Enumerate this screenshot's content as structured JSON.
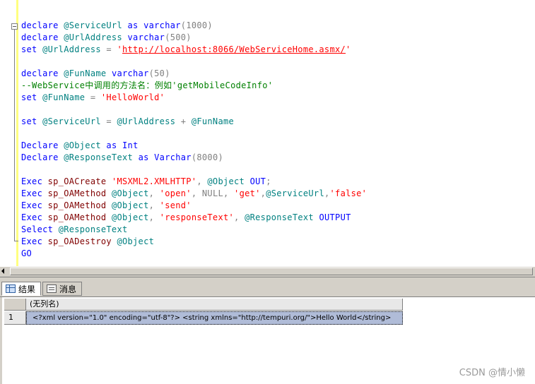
{
  "editor": {
    "fold_symbol": "−",
    "lines": [
      [
        {
          "t": "declare ",
          "c": "kw"
        },
        {
          "t": "@ServiceUrl",
          "c": "var"
        },
        {
          "t": " ",
          "c": ""
        },
        {
          "t": "as",
          "c": "kw"
        },
        {
          "t": " ",
          "c": ""
        },
        {
          "t": "varchar",
          "c": "kw"
        },
        {
          "t": "(1000)",
          "c": "gry"
        }
      ],
      [
        {
          "t": "declare ",
          "c": "kw"
        },
        {
          "t": "@UrlAddress",
          "c": "var"
        },
        {
          "t": " ",
          "c": ""
        },
        {
          "t": "varchar",
          "c": "kw"
        },
        {
          "t": "(500)",
          "c": "gry"
        }
      ],
      [
        {
          "t": "set ",
          "c": "kw"
        },
        {
          "t": "@UrlAddress",
          "c": "var"
        },
        {
          "t": " = ",
          "c": "gry"
        },
        {
          "t": "'",
          "c": "str"
        },
        {
          "t": "http://localhost:8066/WebServiceHome.asmx/",
          "c": "url"
        },
        {
          "t": "'",
          "c": "str"
        }
      ],
      [],
      [
        {
          "t": "declare ",
          "c": "kw"
        },
        {
          "t": "@FunName",
          "c": "var"
        },
        {
          "t": " ",
          "c": ""
        },
        {
          "t": "varchar",
          "c": "kw"
        },
        {
          "t": "(50)",
          "c": "gry"
        }
      ],
      [
        {
          "t": "--WebService中调用的方法名：例如'getMobileCodeInfo'",
          "c": "cmt"
        }
      ],
      [
        {
          "t": "set ",
          "c": "kw"
        },
        {
          "t": "@FunName",
          "c": "var"
        },
        {
          "t": " = ",
          "c": "gry"
        },
        {
          "t": "'HelloWorld'",
          "c": "str"
        }
      ],
      [],
      [
        {
          "t": "set ",
          "c": "kw"
        },
        {
          "t": "@ServiceUrl",
          "c": "var"
        },
        {
          "t": " = ",
          "c": "gry"
        },
        {
          "t": "@UrlAddress",
          "c": "var"
        },
        {
          "t": " + ",
          "c": "gry"
        },
        {
          "t": "@FunName",
          "c": "var"
        }
      ],
      [],
      [
        {
          "t": "Declare ",
          "c": "kw"
        },
        {
          "t": "@Object",
          "c": "var"
        },
        {
          "t": " ",
          "c": ""
        },
        {
          "t": "as",
          "c": "kw"
        },
        {
          "t": " ",
          "c": ""
        },
        {
          "t": "Int",
          "c": "kw"
        }
      ],
      [
        {
          "t": "Declare ",
          "c": "kw"
        },
        {
          "t": "@ResponseText",
          "c": "var"
        },
        {
          "t": " ",
          "c": ""
        },
        {
          "t": "as",
          "c": "kw"
        },
        {
          "t": " ",
          "c": ""
        },
        {
          "t": "Varchar",
          "c": "kw"
        },
        {
          "t": "(8000)",
          "c": "gry"
        }
      ],
      [],
      [
        {
          "t": "Exec ",
          "c": "kw"
        },
        {
          "t": "sp_OACreate",
          "c": "fn"
        },
        {
          "t": " ",
          "c": ""
        },
        {
          "t": "'MSXML2.XMLHTTP'",
          "c": "str"
        },
        {
          "t": ", ",
          "c": "gry"
        },
        {
          "t": "@Object",
          "c": "var"
        },
        {
          "t": " ",
          "c": ""
        },
        {
          "t": "OUT",
          "c": "kw"
        },
        {
          "t": ";",
          "c": "gry"
        }
      ],
      [
        {
          "t": "Exec ",
          "c": "kw"
        },
        {
          "t": "sp_OAMethod",
          "c": "fn"
        },
        {
          "t": " ",
          "c": ""
        },
        {
          "t": "@Object",
          "c": "var"
        },
        {
          "t": ", ",
          "c": "gry"
        },
        {
          "t": "'open'",
          "c": "str"
        },
        {
          "t": ", NULL, ",
          "c": "gry"
        },
        {
          "t": "'get'",
          "c": "str"
        },
        {
          "t": ",",
          "c": "gry"
        },
        {
          "t": "@ServiceUrl",
          "c": "var"
        },
        {
          "t": ",",
          "c": "gry"
        },
        {
          "t": "'false'",
          "c": "str"
        }
      ],
      [
        {
          "t": "Exec ",
          "c": "kw"
        },
        {
          "t": "sp_OAMethod",
          "c": "fn"
        },
        {
          "t": " ",
          "c": ""
        },
        {
          "t": "@Object",
          "c": "var"
        },
        {
          "t": ", ",
          "c": "gry"
        },
        {
          "t": "'send'",
          "c": "str"
        }
      ],
      [
        {
          "t": "Exec ",
          "c": "kw"
        },
        {
          "t": "sp_OAMethod",
          "c": "fn"
        },
        {
          "t": " ",
          "c": ""
        },
        {
          "t": "@Object",
          "c": "var"
        },
        {
          "t": ", ",
          "c": "gry"
        },
        {
          "t": "'responseText'",
          "c": "str"
        },
        {
          "t": ", ",
          "c": "gry"
        },
        {
          "t": "@ResponseText",
          "c": "var"
        },
        {
          "t": " ",
          "c": ""
        },
        {
          "t": "OUTPUT",
          "c": "kw"
        }
      ],
      [
        {
          "t": "Select ",
          "c": "kw"
        },
        {
          "t": "@ResponseText",
          "c": "var"
        }
      ],
      [
        {
          "t": "Exec ",
          "c": "kw"
        },
        {
          "t": "sp_OADestroy",
          "c": "fn"
        },
        {
          "t": " ",
          "c": ""
        },
        {
          "t": "@Object",
          "c": "var"
        }
      ],
      [
        {
          "t": "GO",
          "c": "kw"
        }
      ]
    ]
  },
  "tabs": [
    {
      "label": "结果",
      "icon": "grid-icon",
      "active": true
    },
    {
      "label": "消息",
      "icon": "message-icon",
      "active": false
    }
  ],
  "results": {
    "column_header": "(无列名)",
    "rows": [
      {
        "number": "1",
        "value": "<?xml version=\"1.0\" encoding=\"utf-8\"?>  <string xmlns=\"http://tempuri.org/\">Hello World</string>"
      }
    ]
  },
  "watermark": "CSDN @情小懒",
  "colors": {
    "keyword": "#0000ff",
    "variable": "#008080",
    "string": "#ff0000",
    "comment": "#008000",
    "operator": "#808080",
    "system_proc": "#800000",
    "selected_cell": "#b0bcd8",
    "chrome": "#d4d0c8"
  }
}
